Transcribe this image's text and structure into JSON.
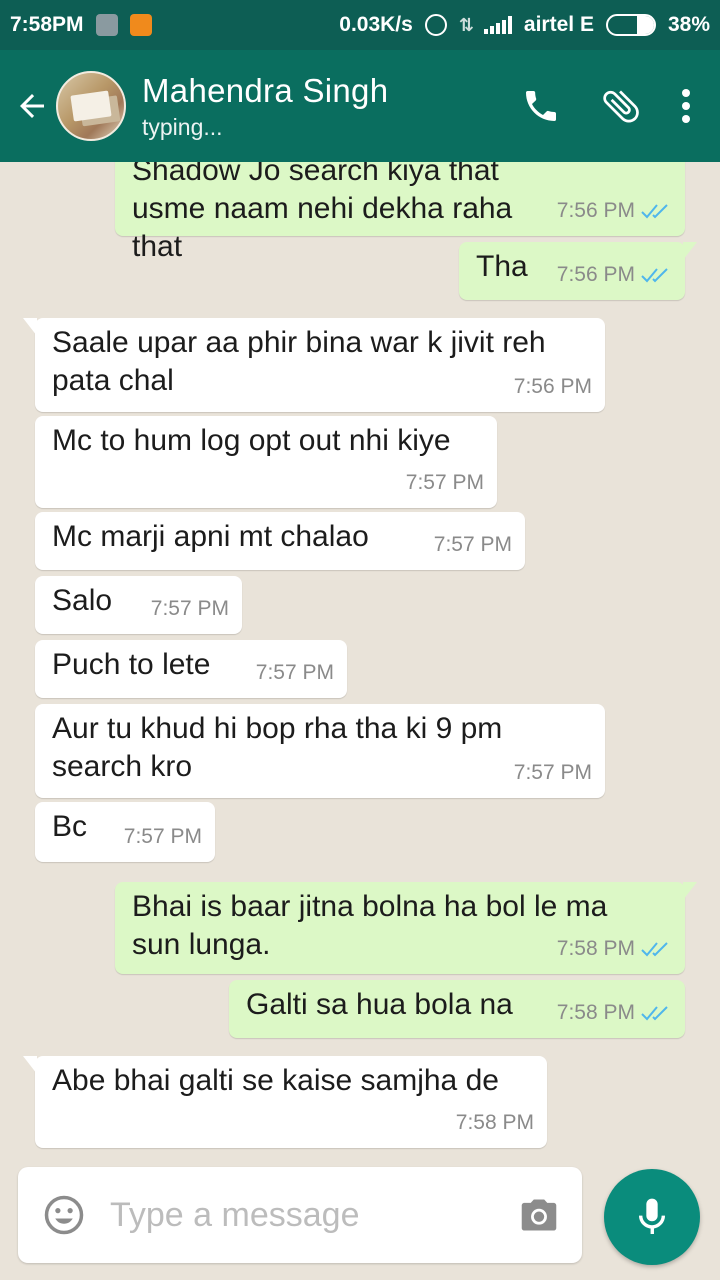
{
  "status_bar": {
    "time": "7:58PM",
    "network_speed": "0.03K/s",
    "carrier": "airtel E",
    "battery_percent": "38%",
    "battery_level": 0.38
  },
  "header": {
    "contact_name": "Mahendra Singh",
    "contact_status": "typing..."
  },
  "messages": [
    {
      "dir": "out",
      "text": "Shadow Jo search kiya that usme naam nehi dekha raha that",
      "time": "7:56 PM",
      "read": true
    },
    {
      "dir": "out",
      "text": "Tha",
      "time": "7:56 PM",
      "read": true
    },
    {
      "dir": "in",
      "text": "Saale upar aa phir bina war k jivit reh pata chal",
      "time": "7:56 PM"
    },
    {
      "dir": "in",
      "text": "Mc to hum log opt out nhi kiye",
      "time": "7:57 PM"
    },
    {
      "dir": "in",
      "text": "Mc marji apni mt chalao",
      "time": "7:57 PM"
    },
    {
      "dir": "in",
      "text": "Salo",
      "time": "7:57 PM"
    },
    {
      "dir": "in",
      "text": "Puch to lete",
      "time": "7:57 PM"
    },
    {
      "dir": "in",
      "text": "Aur tu khud hi bop rha tha ki 9 pm search kro",
      "time": "7:57 PM"
    },
    {
      "dir": "in",
      "text": "Bc",
      "time": "7:57 PM"
    },
    {
      "dir": "out",
      "text": "Bhai is baar jitna bolna ha bol le ma sun lunga.",
      "time": "7:58 PM",
      "read": true
    },
    {
      "dir": "out",
      "text": "Galti sa hua bola na",
      "time": "7:58 PM",
      "read": true
    },
    {
      "dir": "in",
      "text": "Abe bhai galti se kaise samjha de",
      "time": "7:58 PM"
    }
  ],
  "input": {
    "placeholder": "Type a message",
    "value": ""
  },
  "colors": {
    "header": "#0a6e5f",
    "status_bar": "#0d5e54",
    "outgoing_bubble": "#dcf8c6",
    "incoming_bubble": "#ffffff",
    "read_ticks": "#4fb6ec",
    "mic_button": "#0a8c7c"
  },
  "icons": [
    "back-arrow-icon",
    "phone-icon",
    "attach-icon",
    "more-vert-icon",
    "emoji-icon",
    "camera-icon",
    "mic-icon",
    "double-check-icon"
  ]
}
